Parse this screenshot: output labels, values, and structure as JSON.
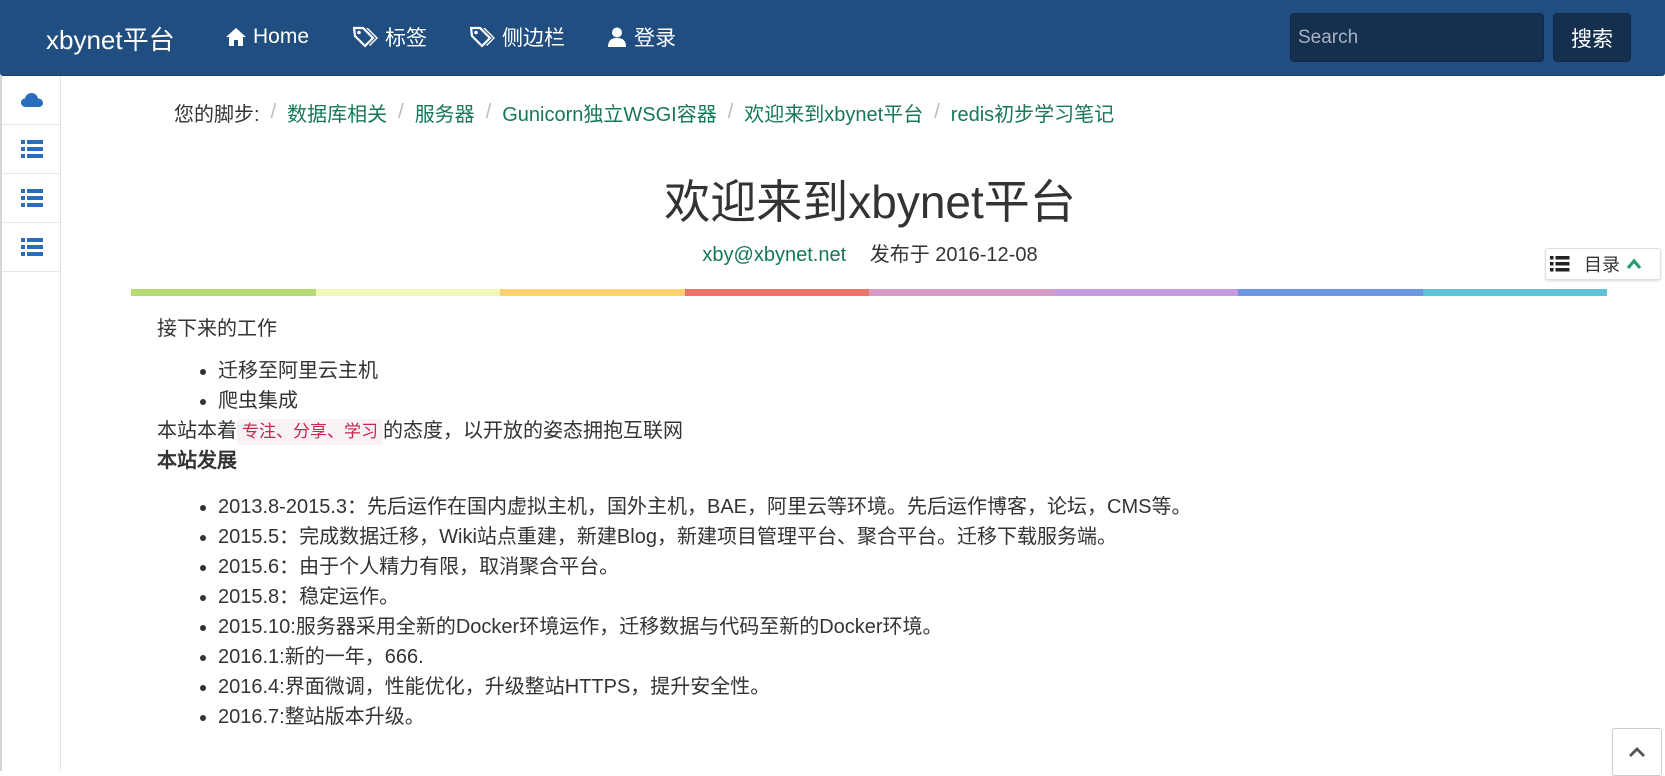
{
  "navbar": {
    "brand": "xbynet平台",
    "items": [
      {
        "label": "Home",
        "icon": "home-icon"
      },
      {
        "label": "标签",
        "icon": "tags-icon"
      },
      {
        "label": "侧边栏",
        "icon": "tags-icon"
      },
      {
        "label": "登录",
        "icon": "user-icon"
      }
    ],
    "search_placeholder": "Search",
    "search_button": "搜索"
  },
  "left_rail": {
    "items": [
      {
        "icon": "cloud-icon"
      },
      {
        "icon": "list-icon"
      },
      {
        "icon": "list-icon"
      },
      {
        "icon": "list-icon"
      }
    ]
  },
  "breadcrumb": {
    "lead": "您的脚步:",
    "links": [
      "数据库相关",
      "服务器",
      "Gunicorn独立WSGI容器",
      "欢迎来到xbynet平台",
      "redis初步学习笔记"
    ]
  },
  "post": {
    "title": "欢迎来到xbynet平台",
    "author": "xby@xbynet.net",
    "published": "发布于 2016-12-08"
  },
  "toc": {
    "label": "目录",
    "icon": "list-icon"
  },
  "stripe_colors": [
    "#b5dc73",
    "#f3f7b6",
    "#fcd271",
    "#ed736a",
    "#d79bc3",
    "#c79be1",
    "#6b98e2",
    "#5ec2d8"
  ],
  "article": {
    "intro": "接下来的工作",
    "todo": [
      "迁移至阿里云主机",
      "爬虫集成"
    ],
    "motto_before": "本站本着",
    "motto_code": "专注、分享、学习",
    "motto_after": "的态度，以开放的姿态拥抱互联网",
    "section_title": "本站发展",
    "history": [
      "2013.8-2015.3：先后运作在国内虚拟主机，国外主机，BAE，阿里云等环境。先后运作博客，论坛，CMS等。",
      "2015.5：完成数据迁移，Wiki站点重建，新建Blog，新建项目管理平台、聚合平台。迁移下载服务端。",
      "2015.6：由于个人精力有限，取消聚合平台。",
      "2015.8：稳定运作。",
      "2015.10:服务器采用全新的Docker环境运作，迁移数据与代码至新的Docker环境。",
      "2016.1:新的一年，666.",
      "2016.4:界面微调，性能优化，升级整站HTTPS，提升安全性。",
      "2016.7:整站版本升级。"
    ]
  },
  "back_to_top": {
    "icon": "chevron-up-icon"
  }
}
